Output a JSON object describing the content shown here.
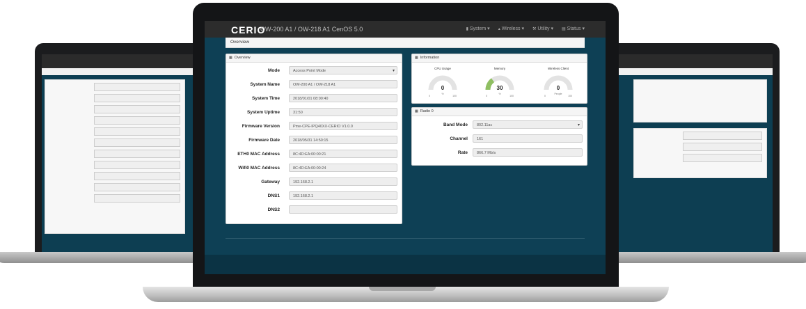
{
  "header": {
    "logo": "CERIO",
    "product": "OW-200 A1 / OW-218 A1   CenOS 5.0",
    "menu": [
      "System",
      "Wireless",
      "Utility",
      "Status"
    ]
  },
  "breadcrumb": "Overview",
  "overview": {
    "title": "Overview",
    "rows": [
      {
        "label": "Mode",
        "value": "Access Point Mode",
        "select": true
      },
      {
        "label": "System Name",
        "value": "OW-200 A1 / OW-218 A1"
      },
      {
        "label": "System Time",
        "value": "2018/01/01 08:00:40"
      },
      {
        "label": "System Uptime",
        "value": "31:50"
      },
      {
        "label": "Firmware Version",
        "value": "Pme-CPE-IPQ40XX-CERIO V1.0.0"
      },
      {
        "label": "Firmware Date",
        "value": "2018/05/31 14:50:15"
      },
      {
        "label": "ETH0 MAC Address",
        "value": "8C:4D:EA:00:00:21"
      },
      {
        "label": "Wifi0 MAC Address",
        "value": "8C:4D:EA:00:00:24"
      },
      {
        "label": "Gateway",
        "value": "192.168.2.1"
      },
      {
        "label": "DNS1",
        "value": "192.168.2.1"
      },
      {
        "label": "DNS2",
        "value": ""
      }
    ]
  },
  "information": {
    "title": "Information",
    "gauges": [
      {
        "title": "CPU Usage",
        "value": "0",
        "min": "0",
        "unit": "%",
        "max": "100",
        "fraction": 0
      },
      {
        "title": "Memory",
        "value": "30",
        "min": "0",
        "unit": "%",
        "max": "100",
        "fraction": 0.3
      },
      {
        "title": "Wireless Client",
        "value": "0",
        "min": "0",
        "unit": "People",
        "max": "100",
        "fraction": 0
      }
    ]
  },
  "radio": {
    "title": "Radio 0",
    "rows": [
      {
        "label": "Band Mode",
        "value": "802.11ac",
        "select": true
      },
      {
        "label": "Channel",
        "value": "161"
      },
      {
        "label": "Rate",
        "value": "866.7 Mb/s"
      }
    ]
  },
  "colors": {
    "accent": "#8fbf62",
    "screen_bg": "#0e4055",
    "topbar": "#2c2c2c"
  },
  "icons": {
    "panel": "table-icon"
  }
}
